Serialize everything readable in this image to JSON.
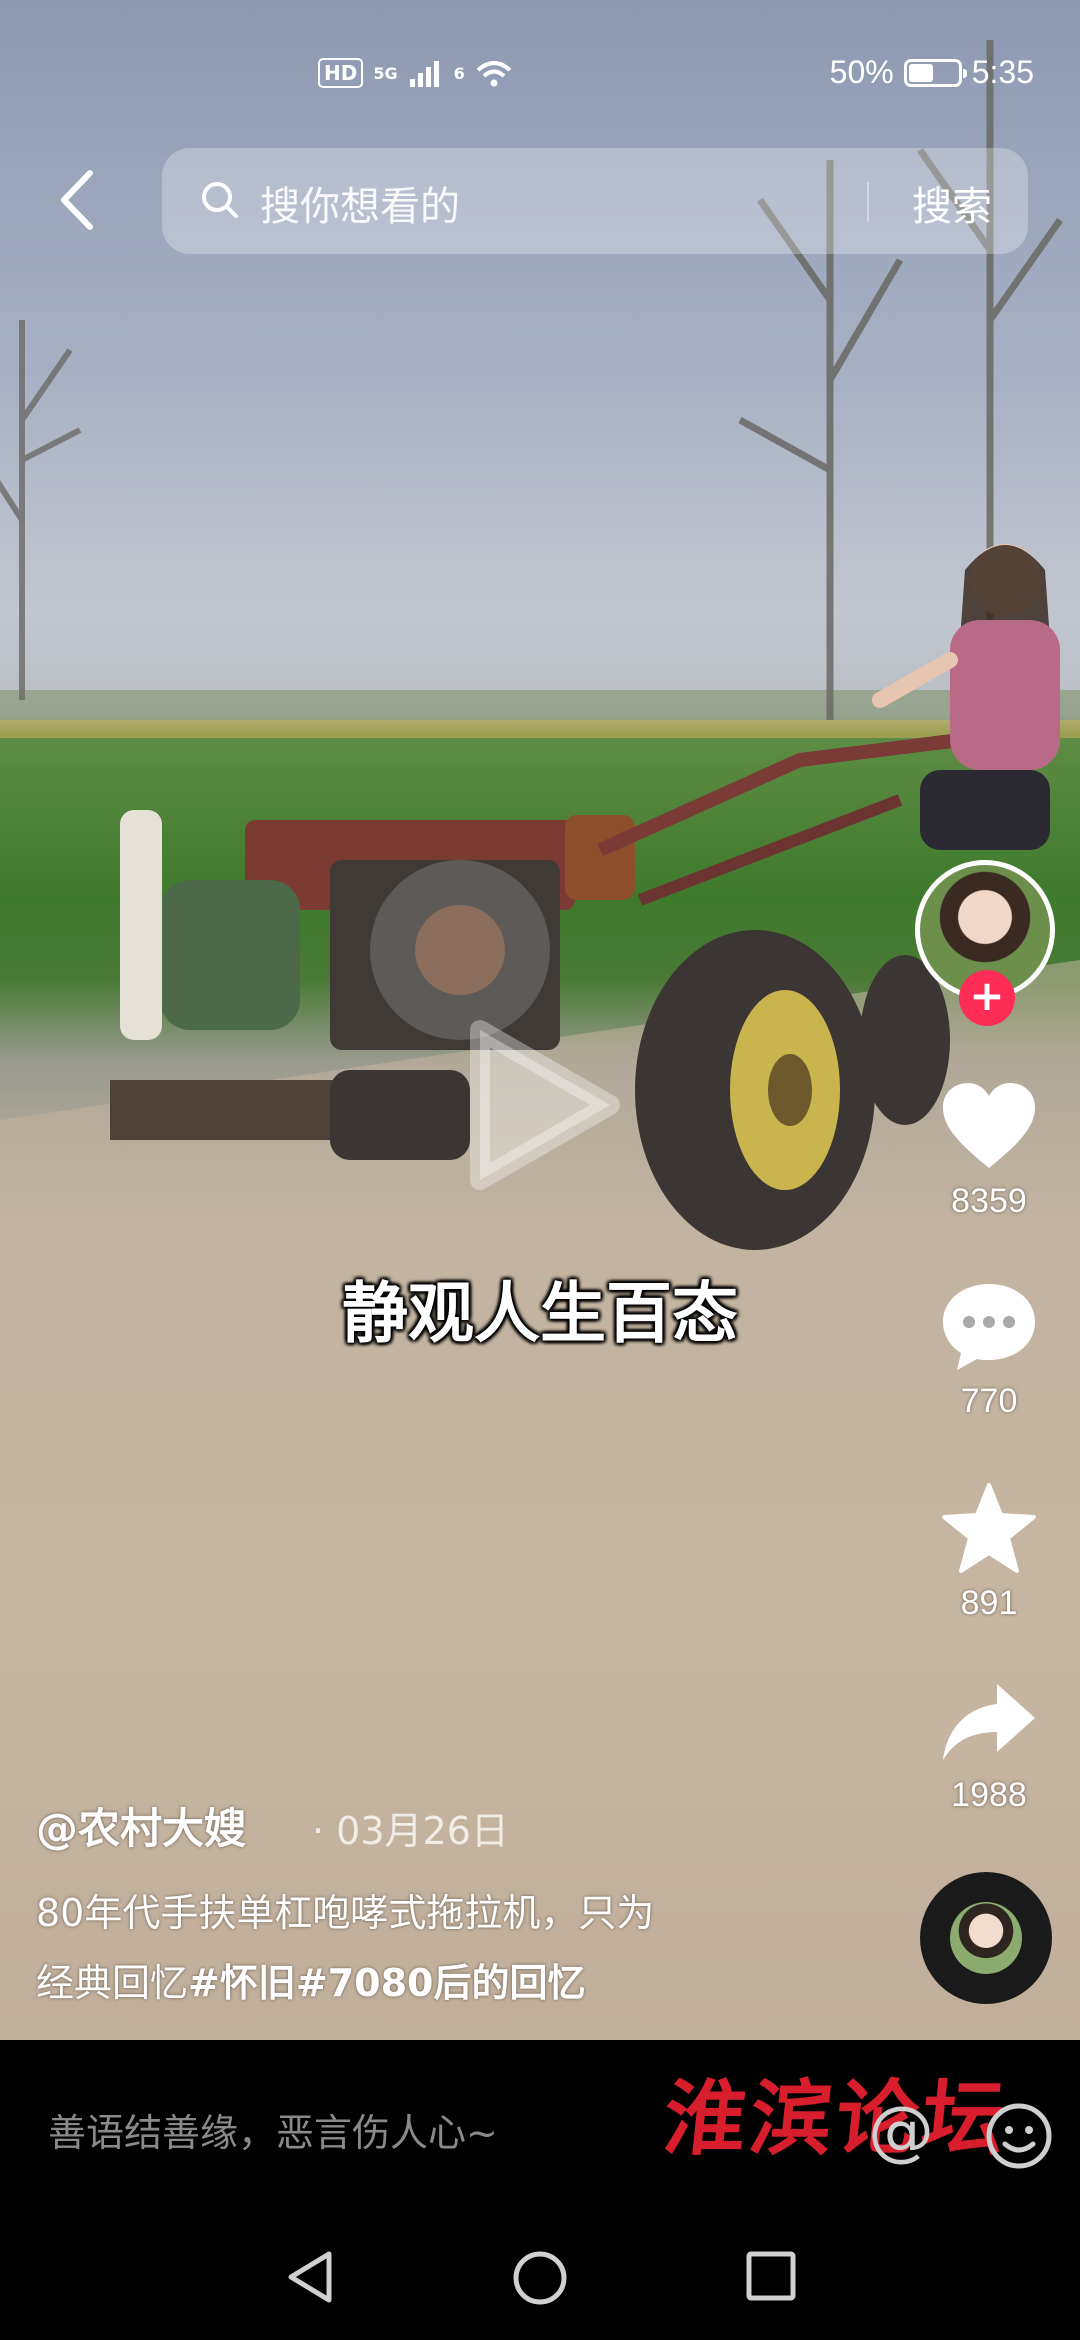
{
  "status_bar": {
    "hd": "HD",
    "network": "5G",
    "wifi": "6",
    "battery": "50%",
    "battery_level": 0.5,
    "time": "5:35"
  },
  "search": {
    "placeholder": "搜你想看的",
    "button": "搜索"
  },
  "video": {
    "caption": "静观人生百态"
  },
  "actions": {
    "likes": "8359",
    "comments": "770",
    "favorites": "891",
    "shares": "1988"
  },
  "post": {
    "author": "@农村大嫂",
    "date": "· 03月26日",
    "description_line1": "80年代手扶单杠咆哮式拖拉机，只为",
    "description_line2_prefix": "经典回忆",
    "hashtags": "#怀旧#7080后的回忆"
  },
  "comment_bar": {
    "placeholder": "善语结善缘，恶言伤人心~",
    "watermark": "淮滨论坛",
    "at_symbol": "@"
  },
  "icons": {
    "back": "back-arrow-icon",
    "search": "search-icon",
    "like": "heart-icon",
    "comment": "comment-icon",
    "favorite": "star-icon",
    "share": "share-icon",
    "emoji": "emoji-icon"
  },
  "colors": {
    "follow_accent": "#ff2c55",
    "watermark": "#d81e2c"
  }
}
